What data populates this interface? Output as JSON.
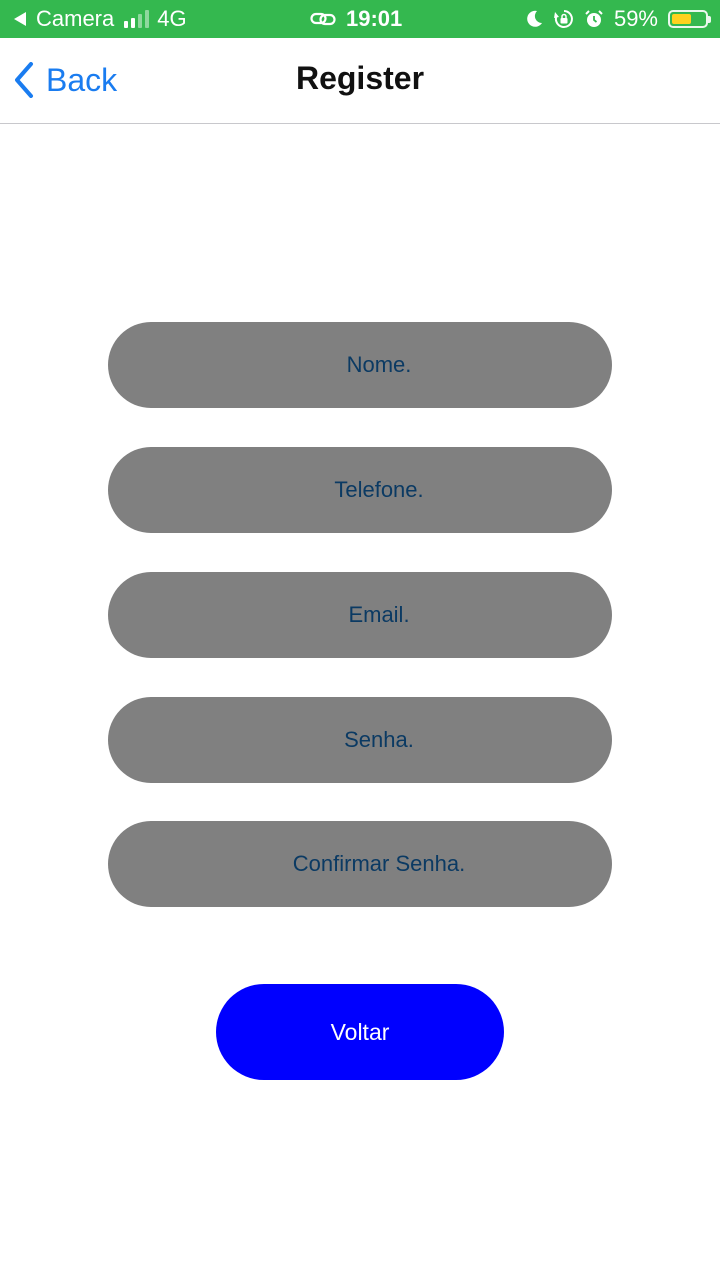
{
  "status_bar": {
    "back_app": "Camera",
    "network": "4G",
    "time": "19:01",
    "battery_percent": "59%",
    "battery_level": 0.59,
    "background_color": "#34b84f",
    "icons": [
      "back-triangle-icon",
      "signal-bars-icon",
      "link-icon",
      "moon-icon",
      "rotation-lock-icon",
      "alarm-icon",
      "battery-icon"
    ]
  },
  "nav": {
    "back_label": "Back",
    "title": "Register",
    "accent_color": "#1a7cf0"
  },
  "form": {
    "nome_placeholder": "Nome.",
    "telefone_placeholder": "Telefone.",
    "email_placeholder": "Email.",
    "senha_placeholder": "Senha.",
    "confirmar_senha_placeholder": "Confirmar Senha.",
    "field_color": "#808080",
    "field_text_color": "#0b3a63"
  },
  "actions": {
    "voltar_label": "Voltar",
    "voltar_color": "#0000ff"
  }
}
